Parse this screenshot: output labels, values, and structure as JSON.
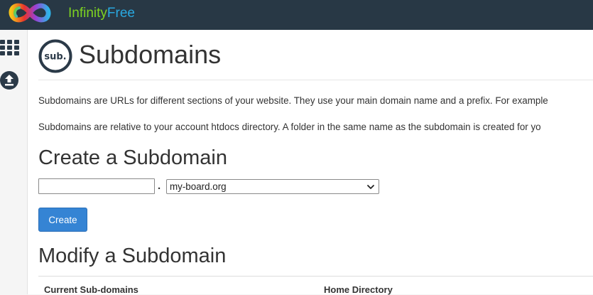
{
  "brand": {
    "name_part1": "Infinity",
    "name_part2": "Free"
  },
  "sidebar": {
    "items": [
      {
        "icon": "apps-grid-icon"
      },
      {
        "icon": "upload-icon"
      }
    ]
  },
  "page": {
    "icon_text": "sub.",
    "title": "Subdomains",
    "intro_1": "Subdomains are URLs for different sections of your website. They use your main domain name and a prefix. For example",
    "intro_2": "Subdomains are relative to your account htdocs directory. A folder in the same name as the subdomain is created for yo"
  },
  "create": {
    "heading": "Create a Subdomain",
    "subdomain_value": "",
    "separator": ".",
    "domain_selected": "my-board.org",
    "button_label": "Create"
  },
  "modify": {
    "heading": "Modify a Subdomain",
    "columns": [
      "Current Sub-domains",
      "Home Directory"
    ]
  },
  "colors": {
    "topbar": "#283845",
    "brand_green": "#7ed321",
    "brand_blue": "#29a8e0",
    "button": "#3584d4"
  }
}
